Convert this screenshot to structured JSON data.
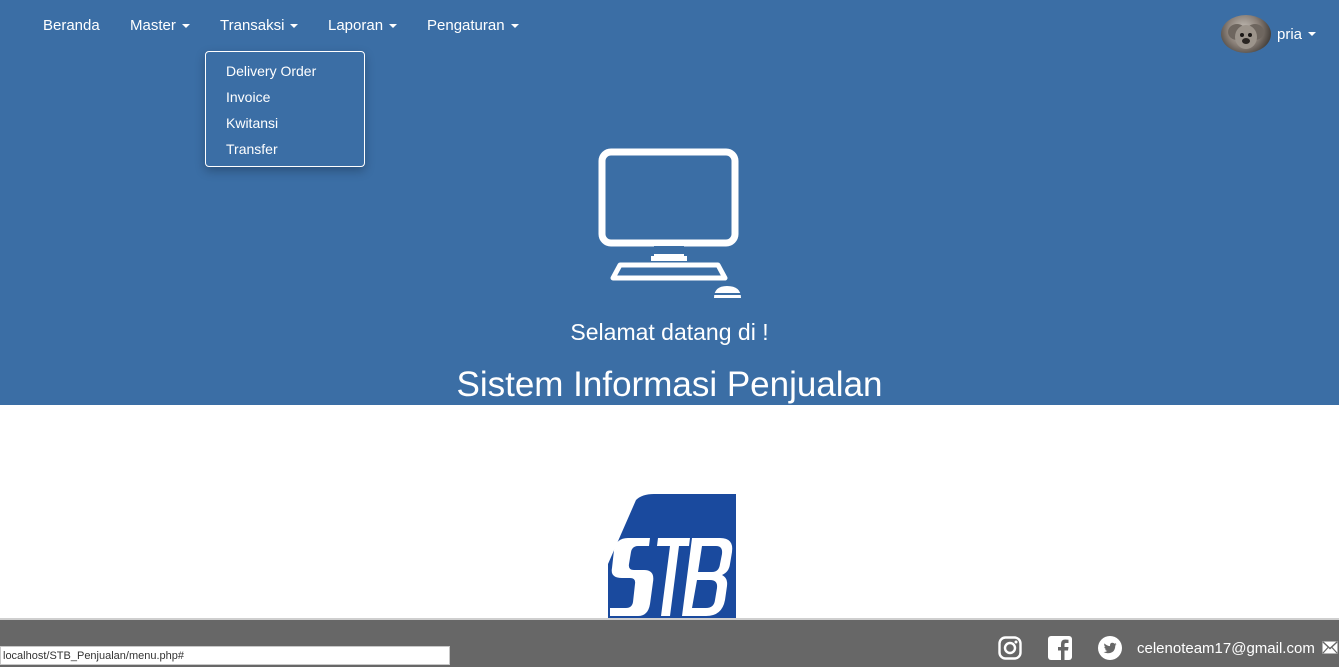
{
  "nav": {
    "items": [
      {
        "label": "Beranda"
      },
      {
        "label": "Master"
      },
      {
        "label": "Transaksi"
      },
      {
        "label": "Laporan"
      },
      {
        "label": "Pengaturan"
      }
    ],
    "dropdown": {
      "items": [
        {
          "label": "Delivery Order"
        },
        {
          "label": "Invoice"
        },
        {
          "label": "Kwitansi"
        },
        {
          "label": "Transfer"
        }
      ]
    },
    "user": {
      "name": "pria"
    }
  },
  "hero": {
    "icon": "desktop-computer-icon",
    "welcome": "Selamat datang di !",
    "system_title": "Sistem Informasi Penjualan"
  },
  "logo": {
    "text": "STB"
  },
  "footer": {
    "icons": [
      "instagram-icon",
      "facebook-icon",
      "twitter-icon",
      "envelope-icon"
    ],
    "email": "celenoteam17@gmail.com"
  },
  "status_bar": {
    "url": "localhost/STB_Penjualan/menu.php#"
  },
  "colors": {
    "hero_bg": "#3b6ea5",
    "footer_bg": "#676767",
    "logo_blue": "#1a4a9e"
  }
}
